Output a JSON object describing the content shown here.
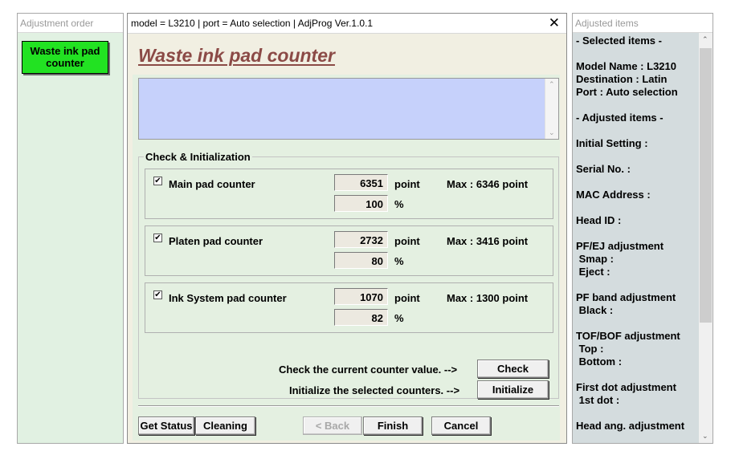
{
  "left_panel": {
    "title": "Adjustment order",
    "items": [
      {
        "label_line1": "Waste ink pad",
        "label_line2": "counter",
        "color": "#22e222"
      }
    ]
  },
  "dialog": {
    "title": "model = L3210 | port = Auto selection | AdjProg Ver.1.0.1",
    "heading": "Waste ink pad counter",
    "group_label": "Check & Initialization",
    "counters": [
      {
        "label": "Main pad counter",
        "checked": true,
        "value": "6351",
        "unit": "point",
        "max": "Max : 6346 point",
        "percent": "100",
        "percent_unit": "%"
      },
      {
        "label": "Platen pad counter",
        "checked": true,
        "value": "2732",
        "unit": "point",
        "max": "Max : 3416 point",
        "percent": "80",
        "percent_unit": "%"
      },
      {
        "label": "Ink System pad counter",
        "checked": true,
        "value": "1070",
        "unit": "point",
        "max": "Max : 1300 point",
        "percent": "82",
        "percent_unit": "%"
      }
    ],
    "check_prompt": "Check the current counter value. -->",
    "check_button": "Check",
    "init_prompt": "Initialize the selected counters. -->",
    "init_button": "Initialize",
    "footer": {
      "get_status": "Get Status",
      "cleaning": "Cleaning",
      "back": "< Back",
      "finish": "Finish",
      "cancel": "Cancel"
    },
    "heading_color": "#8b4a46",
    "log_color": "#c6d1fb"
  },
  "right_panel": {
    "title": "Adjusted items",
    "lines": [
      "- Selected items -",
      "",
      "Model Name : L3210",
      "Destination : Latin",
      "Port : Auto selection",
      "",
      "- Adjusted items -",
      "",
      "Initial Setting :",
      "",
      "Serial No. :",
      "",
      "MAC Address :",
      "",
      "Head ID :",
      "",
      "PF/EJ adjustment",
      " Smap :",
      " Eject :",
      "",
      "PF band adjustment",
      " Black :",
      "",
      "TOF/BOF adjustment",
      " Top :",
      " Bottom :",
      "",
      "First dot adjustment",
      " 1st dot :",
      "",
      "Head ang. adjustment"
    ]
  }
}
